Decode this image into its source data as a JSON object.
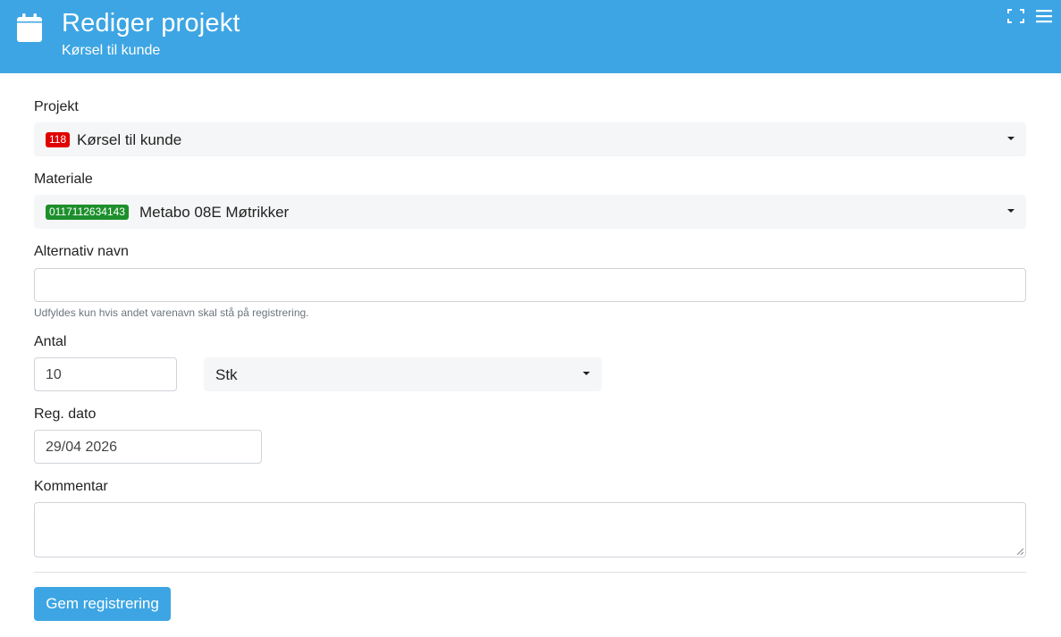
{
  "header": {
    "title": "Rediger projekt",
    "subtitle": "Kørsel til kunde",
    "background_color": "#3da5e3",
    "icons": [
      "calendar-icon",
      "expand-icon",
      "menu-icon"
    ]
  },
  "form": {
    "projekt": {
      "label": "Projekt",
      "badge": "118",
      "badge_color": "#e00000",
      "value": "Kørsel til kunde"
    },
    "materiale": {
      "label": "Materiale",
      "badge": "0117112634143",
      "badge_color": "#1d8f2c",
      "value": "Metabo 08E Møtrikker"
    },
    "alternativ_navn": {
      "label": "Alternativ navn",
      "value": "",
      "help": "Udfyldes kun hvis andet varenavn skal stå på registrering."
    },
    "antal": {
      "label": "Antal",
      "value": "10",
      "unit": "Stk"
    },
    "reg_dato": {
      "label": "Reg. dato",
      "value": "29/04 2026"
    },
    "kommentar": {
      "label": "Kommentar",
      "value": ""
    }
  },
  "actions": {
    "save_label": "Gem registrering"
  }
}
